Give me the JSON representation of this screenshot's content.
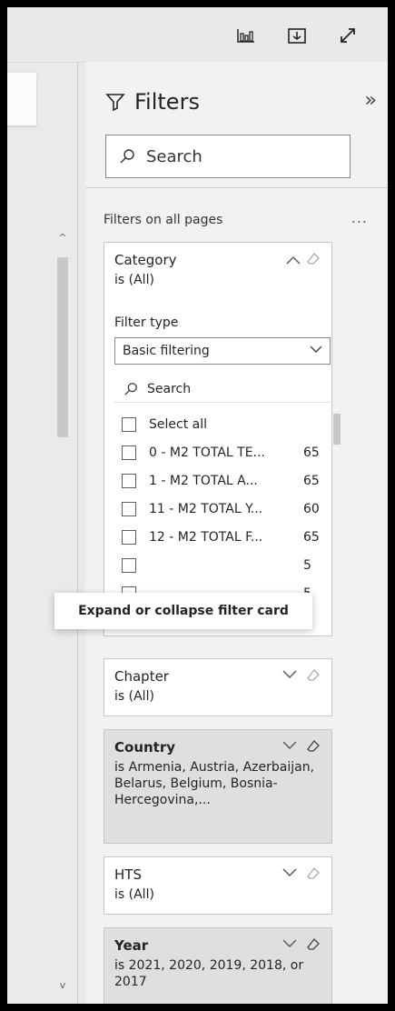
{
  "pane": {
    "title": "Filters",
    "search_placeholder": "Search",
    "section_label": "Filters on all pages",
    "section_more": "..."
  },
  "category_card": {
    "name": "Category",
    "desc": "is (All)",
    "filter_type_label": "Filter type",
    "filter_type_value": "Basic filtering",
    "search_placeholder": "Search",
    "items": [
      {
        "label": "Select all",
        "count": ""
      },
      {
        "label": "0 - M2 TOTAL TE...",
        "count": "65"
      },
      {
        "label": "1 - M2 TOTAL A...",
        "count": "65"
      },
      {
        "label": "11 - M2 TOTAL Y...",
        "count": "60"
      },
      {
        "label": "12 - M2 TOTAL F...",
        "count": "65"
      },
      {
        "label": "",
        "count": "5"
      },
      {
        "label": "",
        "count": "5"
      }
    ]
  },
  "tooltip": "Expand or collapse filter card",
  "chapter_card": {
    "name": "Chapter",
    "desc": "is (All)"
  },
  "country_card": {
    "name": "Country",
    "desc": "is Armenia, Austria, Azerbaijan, Belarus, Belgium, Bosnia-Hercegovina,..."
  },
  "hts_card": {
    "name": "HTS",
    "desc": "is (All)"
  },
  "year_card": {
    "name": "Year",
    "desc": "is 2021, 2020, 2019, 2018, or 2017"
  }
}
